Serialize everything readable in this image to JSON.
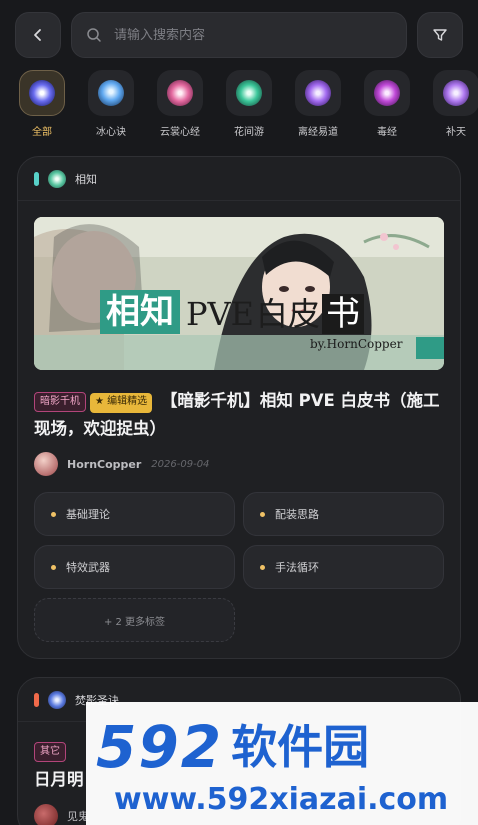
{
  "search": {
    "placeholder": "请输入搜索内容"
  },
  "categories": [
    {
      "label": "全部",
      "icon": "all-icon",
      "color": "#6a6cf0",
      "active": true
    },
    {
      "label": "冰心诀",
      "icon": "ice-heart-icon",
      "color": "#5fa8f0"
    },
    {
      "label": "云裳心经",
      "icon": "cloud-dress-icon",
      "color": "#e46aa0"
    },
    {
      "label": "花间游",
      "icon": "flower-icon",
      "color": "#3cc79a"
    },
    {
      "label": "离经易道",
      "icon": "healing-icon",
      "color": "#a36bf0"
    },
    {
      "label": "毒经",
      "icon": "poison-icon",
      "color": "#c04ad8"
    },
    {
      "label": "补天",
      "icon": "mend-sky-icon",
      "color": "#b07af0"
    }
  ],
  "post1": {
    "section_title": "相知",
    "section_color": "#58d1c9",
    "banner": {
      "main": "相知",
      "pve": "PVE",
      "white": "白皮",
      "book": "书",
      "byline": "by.HornCopper"
    },
    "pill_author": "暗影千机",
    "pill_editor": "★ 编辑精选",
    "title": "【暗影千机】相知 PVE 白皮书（施工现场，欢迎捉虫）",
    "author": "HornCopper",
    "date": "2026-09-04",
    "tags": [
      "基础理论",
      "配装思路",
      "特效武器",
      "手法循环"
    ],
    "more_tags": "+ 2 更多标签"
  },
  "post2": {
    "section_title": "焚影圣诀",
    "section_color": "#f06a4a",
    "pill": "其它",
    "title": "日月明",
    "author": "见鬼"
  },
  "watermark": {
    "num": "592",
    "cn": "软件园",
    "url": "www.592xiazai.com"
  }
}
